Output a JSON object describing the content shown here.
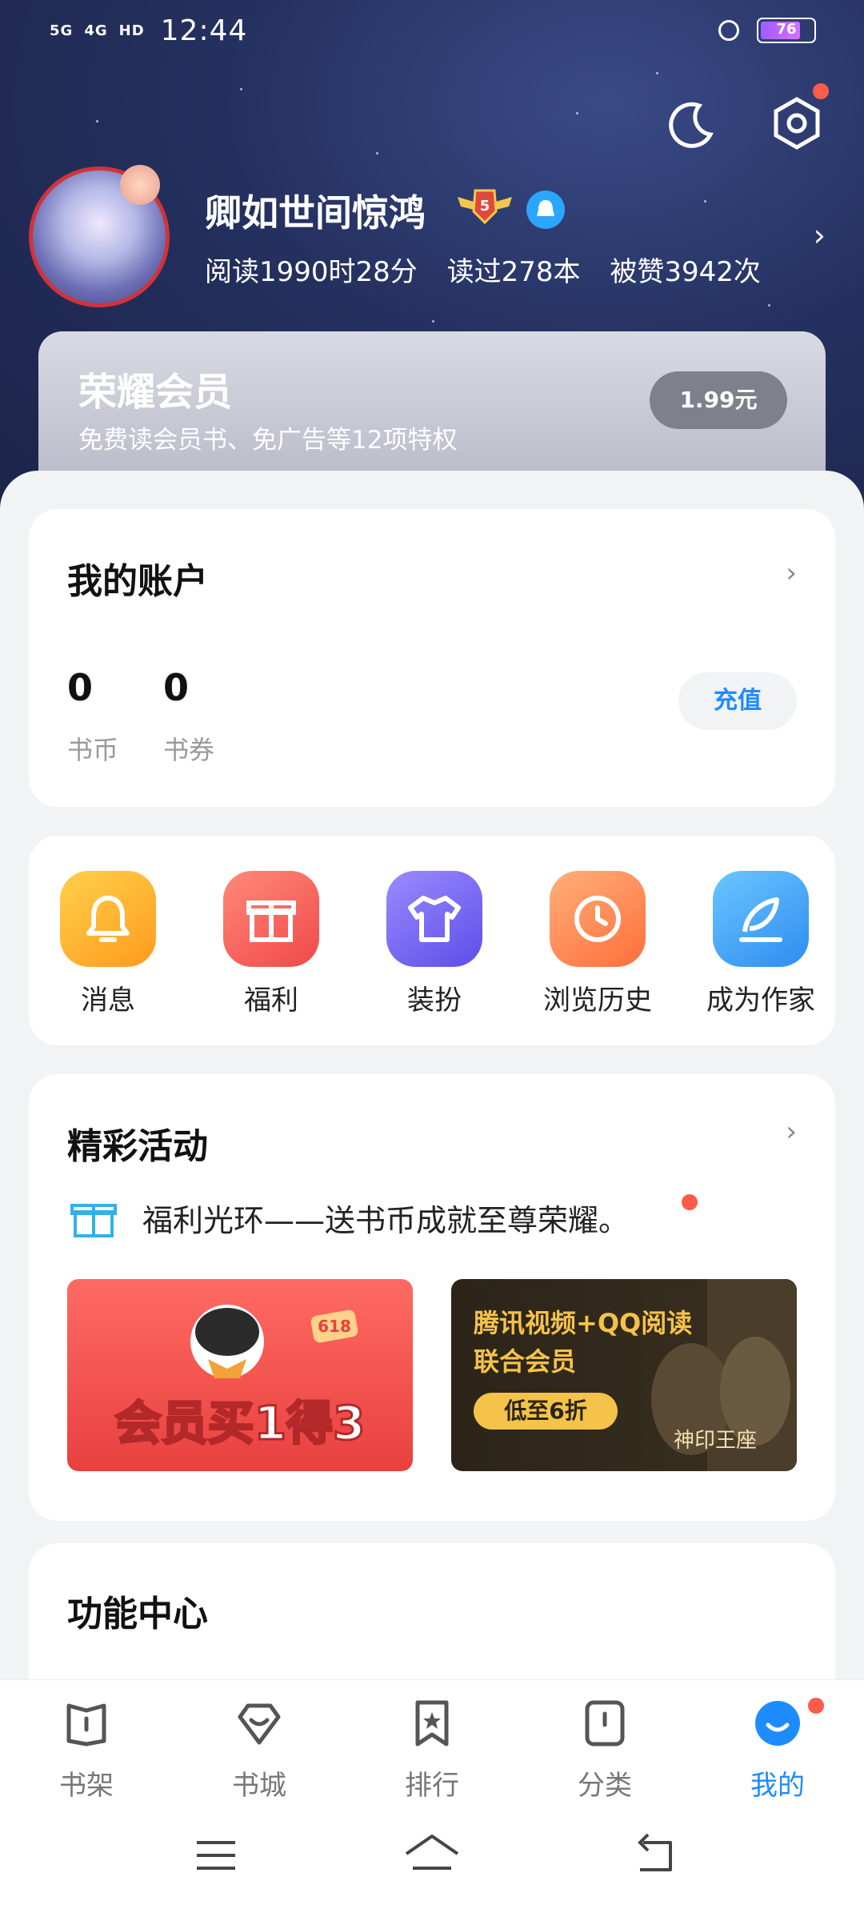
{
  "status_bar": {
    "network1": "5G",
    "network2": "4G",
    "hd": "HD",
    "time": "12:44",
    "battery": "76"
  },
  "profile": {
    "username": "卿如世间惊鸿",
    "level": "5",
    "stats": [
      "阅读1990时28分",
      "读过278本",
      "被赞3942次"
    ]
  },
  "vip": {
    "title": "荣耀会员",
    "subtitle": "免费读会员书、免广告等12项特权",
    "price": "1.99元"
  },
  "account": {
    "title": "我的账户",
    "coins_value": "0",
    "coins_label": "书币",
    "vouchers_value": "0",
    "vouchers_label": "书券",
    "recharge": "充值"
  },
  "shortcuts": [
    {
      "label": "消息",
      "icon": "bell-icon",
      "color": "#ffb02e"
    },
    {
      "label": "福利",
      "icon": "gift-icon",
      "color": "#ff5e5e"
    },
    {
      "label": "装扮",
      "icon": "shirt-icon",
      "color": "#7a6cf5"
    },
    {
      "label": "浏览历史",
      "icon": "clock-icon",
      "color": "#ff8a4c"
    },
    {
      "label": "成为作家",
      "icon": "feather-icon",
      "color": "#3ea1ff"
    }
  ],
  "activities": {
    "title": "精彩活动",
    "line": "福利光环——送书币成就至尊荣耀。",
    "banner1": {
      "text": "会员买1得3",
      "tag": "618"
    },
    "banner2": {
      "line1": "腾讯视频+QQ阅读",
      "line2": "联合会员",
      "pill": "低至6折",
      "logo": "神印王座"
    }
  },
  "functions": {
    "title": "功能中心"
  },
  "bottom_nav": [
    {
      "label": "书架",
      "icon": "bookshelf-icon"
    },
    {
      "label": "书城",
      "icon": "bookstore-icon"
    },
    {
      "label": "排行",
      "icon": "ranking-icon"
    },
    {
      "label": "分类",
      "icon": "category-icon"
    },
    {
      "label": "我的",
      "icon": "profile-icon"
    }
  ],
  "colors": {
    "accent": "#1e8cff",
    "header_bg": "#24305f",
    "notification_dot": "#ff5a4a"
  }
}
